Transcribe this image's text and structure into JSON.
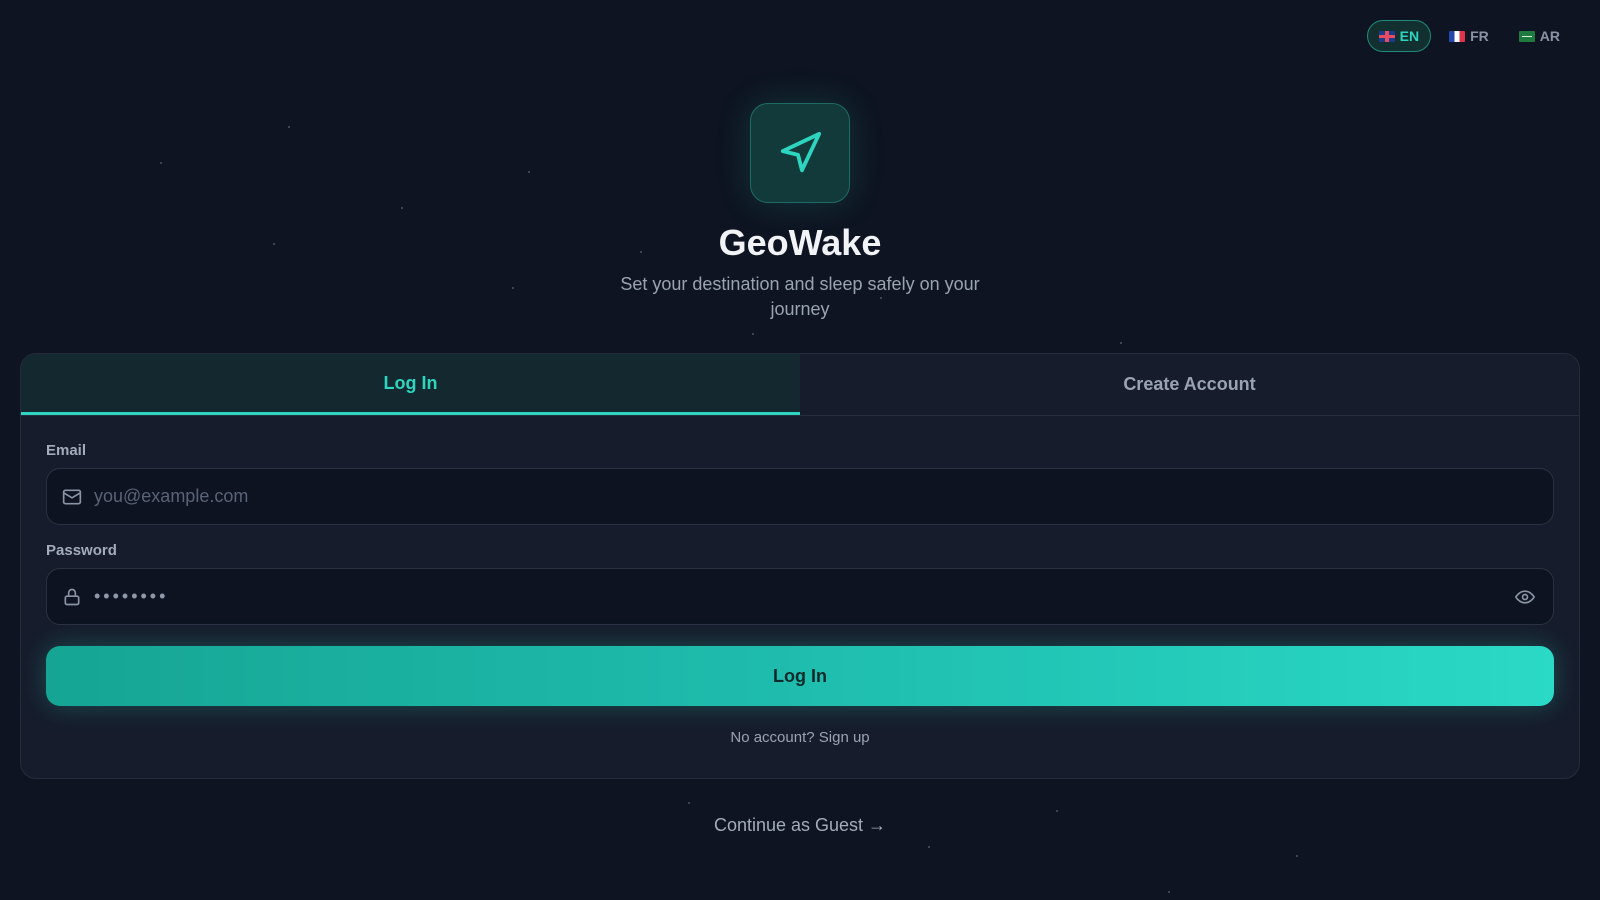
{
  "languages": [
    {
      "code": "EN",
      "flag": "gb-flag-icon",
      "active": true
    },
    {
      "code": "FR",
      "flag": "fr-flag-icon",
      "active": false
    },
    {
      "code": "AR",
      "flag": "sa-flag-icon",
      "active": false
    }
  ],
  "brand": {
    "logo_icon": "navigation-arrow-icon",
    "title": "GeoWake",
    "subtitle": "Set your destination and sleep safely on your journey"
  },
  "tabs": [
    {
      "label": "Log In",
      "active": true
    },
    {
      "label": "Create Account",
      "active": false
    }
  ],
  "form": {
    "email_label": "Email",
    "email_placeholder": "you@example.com",
    "email_icon": "mail-icon",
    "password_label": "Password",
    "password_value": "••••••••",
    "password_icon": "lock-icon",
    "reveal_icon": "eye-icon",
    "submit_label": "Log In",
    "signup_prefix": "No account?",
    "signup_link": "Sign up"
  },
  "guest_link": "Continue as Guest →",
  "colors": {
    "background": "#0e1421",
    "card": "#161c2b",
    "accent": "#2dd4bf"
  }
}
